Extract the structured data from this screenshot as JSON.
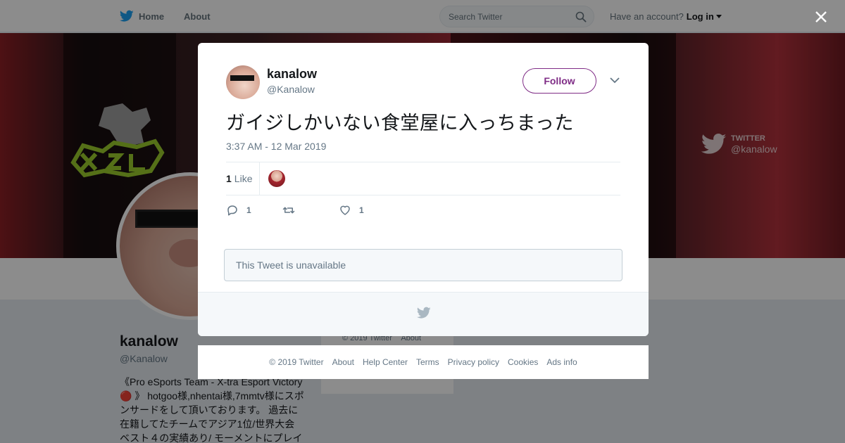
{
  "topnav": {
    "home_label": "Home",
    "about_label": "About",
    "search_placeholder": "Search Twitter",
    "account_prompt": "Have an account?",
    "login_label": "Log in"
  },
  "profile": {
    "name": "kanalow",
    "handle": "@Kanalow",
    "bio": "《Pro eSports Team - X-tra Esport Victory 🔴 》 hotgoo様,nhentai様,7mmtv様にスポンサードをして頂いております。 過去に在籍してたチームでアジア1位/世界大会ベスト４の実績あり/ モーメントにプレイ",
    "banner_watermark_line1": "TWITTER",
    "banner_watermark_line2": "@kanalow",
    "side_footer": [
      "© 2019 Twitter",
      "About"
    ]
  },
  "tweet": {
    "author_name": "kanalow",
    "author_handle": "@Kanalow",
    "follow_label": "Follow",
    "text": "ガイジしかいない食堂屋に入っちまった",
    "timestamp": "3:37 AM - 12 Mar 2019",
    "like_count": "1",
    "like_label": "Like",
    "reply_count": "1",
    "retweet_count": "",
    "favorite_count": "1",
    "quoted_unavailable": "This Tweet is unavailable"
  },
  "footer": {
    "links": [
      "© 2019 Twitter",
      "About",
      "Help Center",
      "Terms",
      "Privacy policy",
      "Cookies",
      "Ads info"
    ]
  },
  "icons": {
    "brand": "twitter-bird-icon",
    "search": "search-icon",
    "close": "close-icon",
    "more": "chevron-down-icon",
    "reply": "reply-icon",
    "retweet": "retweet-icon",
    "like": "heart-icon"
  },
  "colors": {
    "twitter_blue": "#1da1f2",
    "follow_accent": "#7f2c86",
    "muted_text": "#657786"
  }
}
